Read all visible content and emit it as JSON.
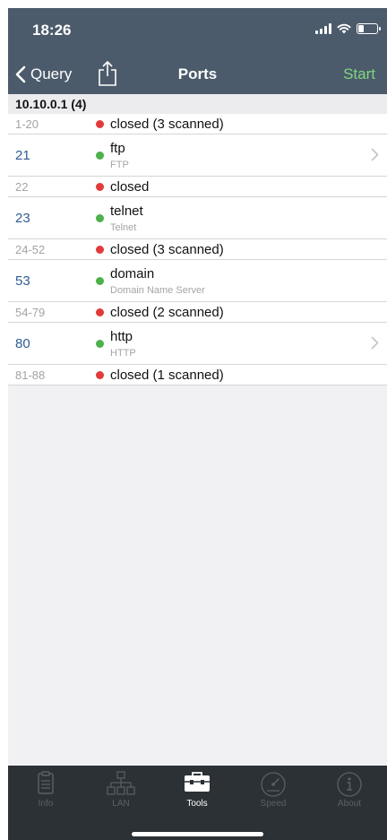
{
  "status_bar": {
    "time": "18:26"
  },
  "nav": {
    "back_label": "Query",
    "title": "Ports",
    "start_label": "Start"
  },
  "section": {
    "title": "10.10.0.1 (4)"
  },
  "rows": [
    {
      "port": "1-20",
      "state": "closed",
      "status": "closed (3 scanned)"
    },
    {
      "port": "21",
      "state": "open",
      "service": "ftp",
      "description": "FTP",
      "has_detail": true
    },
    {
      "port": "22",
      "state": "closed",
      "status": "closed"
    },
    {
      "port": "23",
      "state": "open",
      "service": "telnet",
      "description": "Telnet",
      "has_detail": false
    },
    {
      "port": "24-52",
      "state": "closed",
      "status": "closed (3 scanned)"
    },
    {
      "port": "53",
      "state": "open",
      "service": "domain",
      "description": "Domain Name Server",
      "has_detail": false
    },
    {
      "port": "54-79",
      "state": "closed",
      "status": "closed (2 scanned)"
    },
    {
      "port": "80",
      "state": "open",
      "service": "http",
      "description": "HTTP",
      "has_detail": true
    },
    {
      "port": "81-88",
      "state": "closed",
      "status": "closed (1 scanned)"
    }
  ],
  "tabs": [
    {
      "label": "Info",
      "icon": "clipboard-icon",
      "active": false
    },
    {
      "label": "LAN",
      "icon": "network-icon",
      "active": false
    },
    {
      "label": "Tools",
      "icon": "toolbox-icon",
      "active": true
    },
    {
      "label": "Speed",
      "icon": "speedometer-icon",
      "active": false
    },
    {
      "label": "About",
      "icon": "info-icon",
      "active": false
    }
  ],
  "colors": {
    "header_bg": "#4c5b6b",
    "start": "#7fd77f",
    "open_dot": "#4db14c",
    "closed_dot": "#e23a3a",
    "port_link": "#2f5b95",
    "tabbar_bg": "#2c3136"
  }
}
